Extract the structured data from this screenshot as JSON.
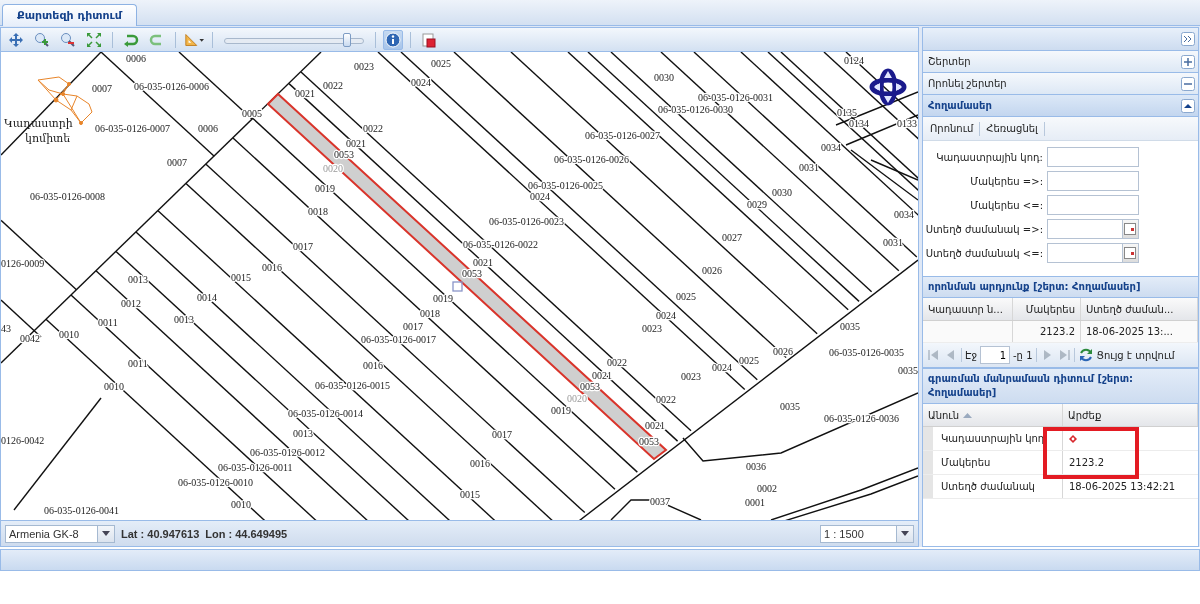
{
  "tab_bar": {
    "tabs": [
      {
        "label": "Քարտեզի դիտում",
        "selected": true
      }
    ]
  },
  "map_panel": {
    "toolbar": {
      "zoom_slider": {
        "level": 0.88
      },
      "info_button": {
        "pressed": true
      }
    },
    "logo": {
      "lines": [
        "Կադաստրի",
        "կոմիտե"
      ]
    },
    "parcel_labels": [
      "0006",
      "0007",
      "06-035-0126-0006",
      "06-035-0126-0007",
      "0006",
      "0007",
      "06-035-0126-0008",
      "0126-0009",
      "0005",
      "0021",
      "0022",
      "0023",
      "0025",
      "0024",
      "0022",
      "0021",
      "0053",
      "0019",
      "0018",
      "0017",
      "0016",
      "0015",
      "0014",
      "0013",
      "0013",
      "0012",
      "0011",
      "0011",
      "0010",
      "0010",
      "43",
      "0042",
      "0126-0042",
      "0019",
      "0018",
      "0017",
      "06-035-0126-0017",
      "0016",
      "06-035-0126-0015",
      "06-035-0126-0014",
      "0013",
      "06-035-0126-0012",
      "06-035-0126-0011",
      "06-035-0126-0010",
      "0010",
      "06-035-0126-0041",
      "0030",
      "06-035-0126-0031",
      "06-035-0126-0030",
      "06-035-0126-0027",
      "06-035-0126-0026",
      "06-035-0126-0025",
      "0024",
      "06-035-0126-0023",
      "06-035-0126-0022",
      "0021",
      "0053",
      "0124",
      "0135",
      "0134",
      "0133",
      "0034",
      "0031",
      "0030",
      "0029",
      "0027",
      "0026",
      "0025",
      "0024",
      "0023",
      "0034",
      "0031",
      "0035",
      "06-035-0126-0035",
      "0035",
      "0026",
      "0025",
      "0024",
      "0023",
      "0022",
      "0021",
      "0053",
      "0019",
      "0022",
      "0035",
      "06-035-0126-0036",
      "0017",
      "0021",
      "0053",
      "0016",
      "0036",
      "0015",
      "0037",
      "0002",
      "0001"
    ],
    "selected_parcel": {
      "labels": [
        "0020",
        "0020"
      ]
    },
    "status_bar": {
      "projection": "Armenia GK-8",
      "latitude": "Lat : 40.947613",
      "longitude": "Lon : 44.649495",
      "scale": "1 : 1500"
    }
  },
  "side_panel": {
    "sections": [
      {
        "title": "Շերտեր",
        "expanded": false,
        "active": false
      },
      {
        "title": "Որոնել շերտեր",
        "expanded": true,
        "active": false
      },
      {
        "title": "Հողամասեր",
        "expanded": true,
        "active": true
      }
    ],
    "search_toolbar": [
      "Որոնում",
      "Հեռացնել"
    ],
    "fields": [
      {
        "label": "Կադաստրային կոդ:",
        "kind": "text"
      },
      {
        "label": "Մակերես =>:",
        "kind": "text"
      },
      {
        "label": "Մակերես <=:",
        "kind": "text"
      },
      {
        "label": "Ստեղծ ժամանակ =>:",
        "kind": "date"
      },
      {
        "label": "Ստեղծ ժամանակ <=:",
        "kind": "date"
      }
    ],
    "results": {
      "title": "որոնման արդյունք [շերտ: Հողամասեր]",
      "columns": [
        "Կադաստր ն...",
        "Մակերես",
        "Ստեղծ ժաման..."
      ],
      "rows": [
        {
          "area": "2123.2",
          "created": "18-06-2025 13:..."
        }
      ]
    },
    "pager": {
      "buttons": [
        {
          "kind": "first",
          "disabled": true
        },
        {
          "kind": "prev",
          "disabled": true
        },
        {
          "kind": "next",
          "disabled": true
        },
        {
          "kind": "last",
          "disabled": true
        }
      ],
      "page_label": "Էջ",
      "page": "1",
      "of": "-ը 1",
      "status": "Ցույց է տրվում"
    },
    "details": {
      "title": "գրառման մանրամասն դիտում [շերտ: Հողամասեր]",
      "columns": [
        "Անուն",
        "Արժեք"
      ],
      "rows": [
        {
          "name": "Կադաստրային կոդ",
          "kind": "marker"
        },
        {
          "name": "Մակերես",
          "kind": "text",
          "value": "2123.2"
        },
        {
          "name": "Ստեղծ ժամանակ",
          "kind": "text",
          "value": "18-06-2025 13:42:21"
        }
      ]
    }
  }
}
